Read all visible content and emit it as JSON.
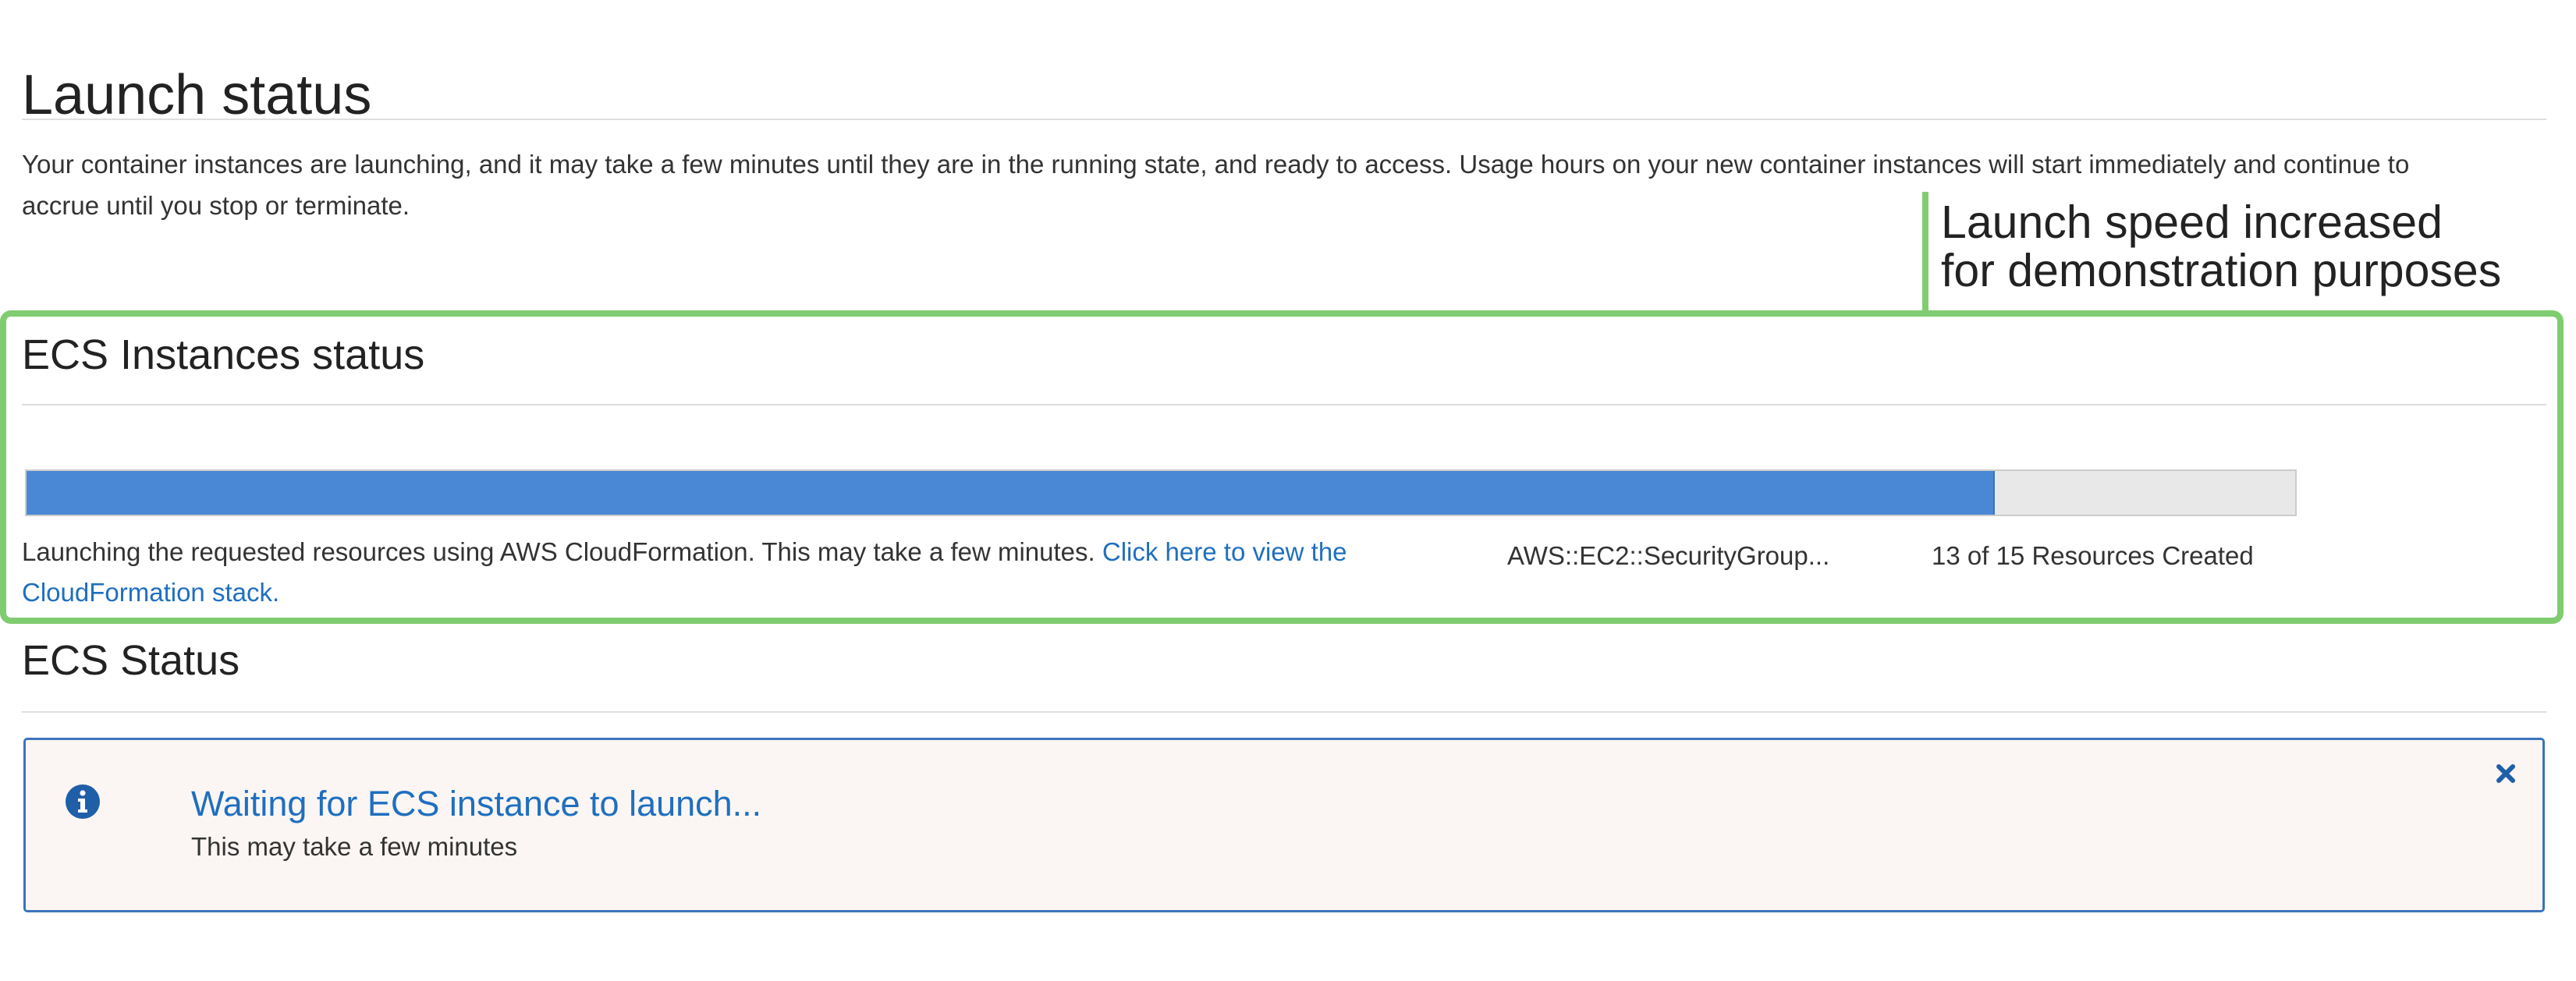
{
  "launch": {
    "title": "Launch status",
    "intro": "Your container instances are launching, and it may take a few minutes until they are in the running state, and ready to access. Usage hours on your new container instances will start immediately and continue to accrue until you stop or terminate."
  },
  "callout": {
    "line1": "Launch speed increased",
    "line2": "for demonstration purposes",
    "color": "#80cc70"
  },
  "instances": {
    "title": "ECS Instances status",
    "progress_fraction": 0.867,
    "progress_color": "#4a88d6",
    "message": "Launching the requested resources using AWS CloudFormation. This may take a few minutes.",
    "link_text": "Click here to view the CloudFormation stack.",
    "current_resource": "AWS::EC2::SecurityGroup...",
    "resource_count": "13 of 15 Resources Created"
  },
  "ecs_status": {
    "title": "ECS Status",
    "alert": {
      "icon": "info-icon",
      "title": "Waiting for ECS instance to launch...",
      "subtitle": "This may take a few minutes",
      "close_icon": "close-icon",
      "border_color": "#3b74bd",
      "title_color": "#1f6fbf"
    }
  }
}
